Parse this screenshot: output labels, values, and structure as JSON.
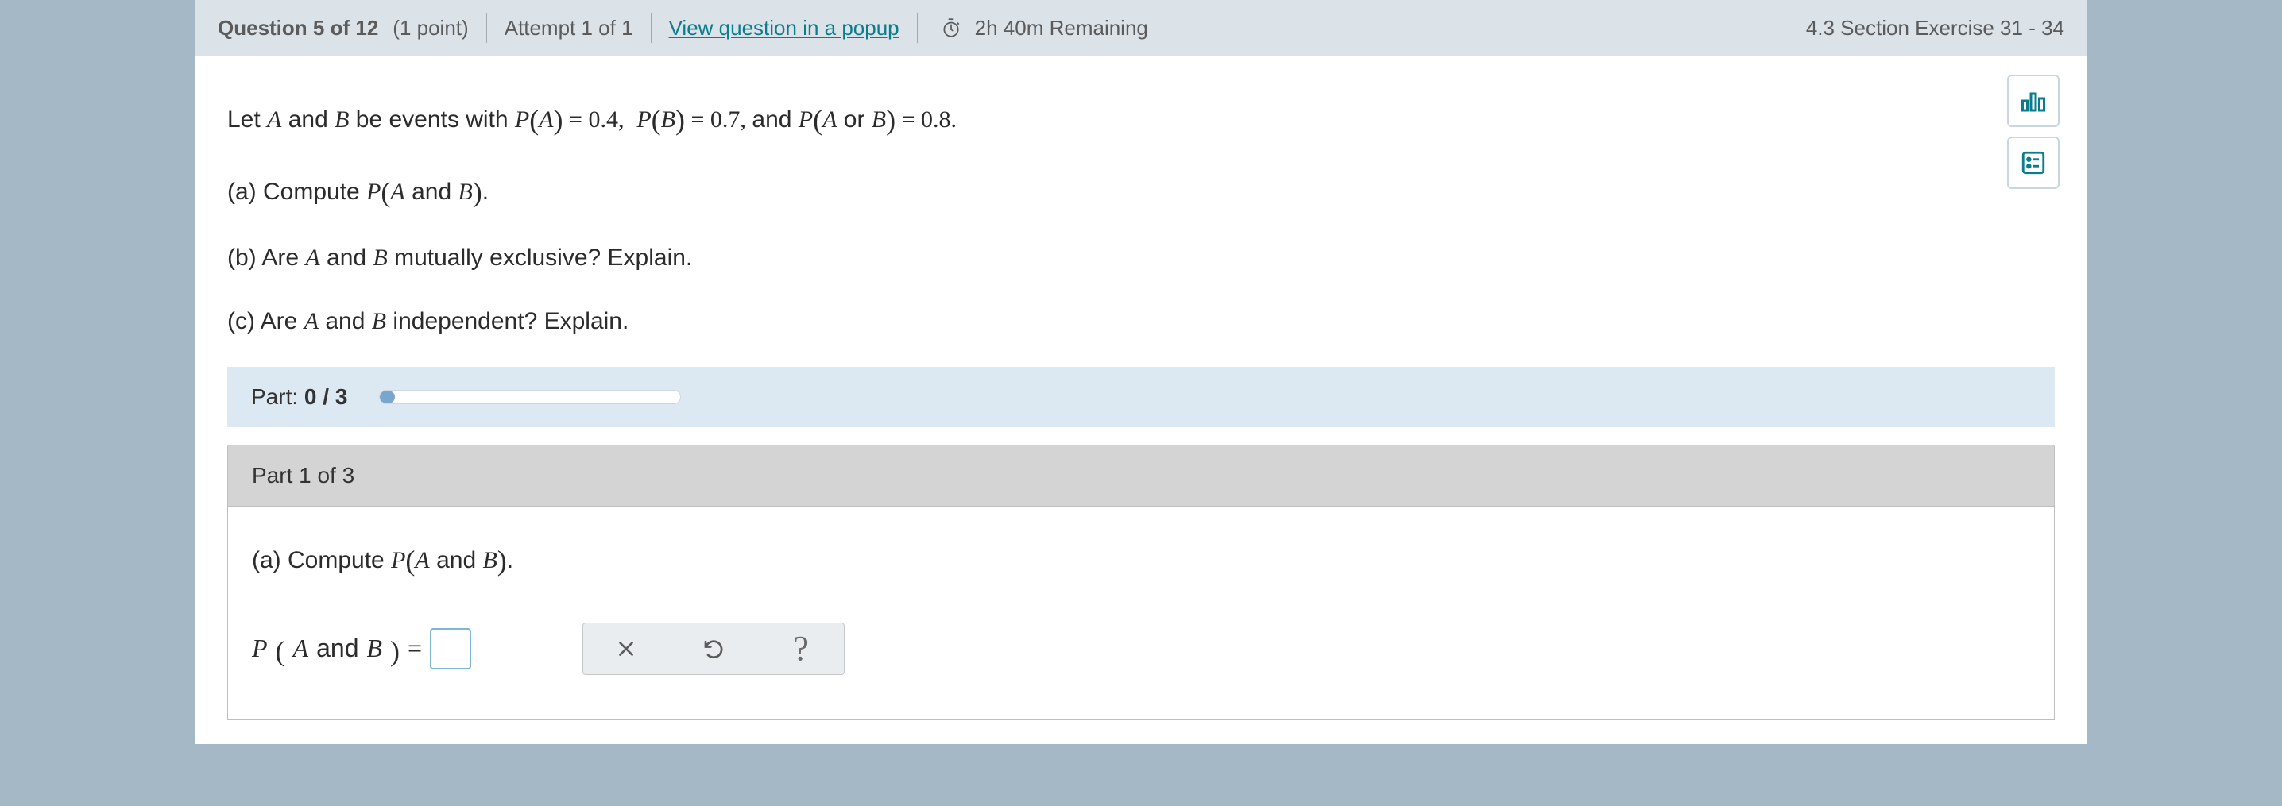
{
  "header": {
    "question_label_prefix": "Question ",
    "question_num": "5",
    "question_of": " of ",
    "question_total": "12",
    "points": "(1 point)",
    "attempt": "Attempt 1 of 1",
    "popup_link": "View question in a popup",
    "time_remaining": "2h 40m Remaining",
    "section_label": "4.3 Section Exercise 31 - 34"
  },
  "tools": {
    "chart_icon": "chart",
    "list_icon": "list"
  },
  "question": {
    "intro_prefix": "Let ",
    "A": "A",
    "and_word": " and ",
    "B": "B",
    "intro_suffix": " be events with ",
    "PA": "P",
    "PA_arg": "A",
    "PA_val": " = 0.4, ",
    "PB": "P",
    "PB_arg": "B",
    "PB_val": " = 0.7, ",
    "and2": " and ",
    "PAB": "P",
    "PAB_arg_A": "A",
    "or_word": " or ",
    "PAB_arg_B": "B",
    "PAB_val": " = 0.8.",
    "a_label": "(a) Compute ",
    "a_P": "P",
    "a_arg_A": "A",
    "a_and": " and ",
    "a_arg_B": "B",
    "a_end": ".",
    "b_text_pre": "(b) Are ",
    "b_A": "A",
    "b_and": " and ",
    "b_B": "B",
    "b_text_post": " mutually exclusive? Explain.",
    "c_text_pre": "(c) Are ",
    "c_A": "A",
    "c_and": " and ",
    "c_B": "B",
    "c_text_post": " independent? Explain."
  },
  "progress": {
    "label_prefix": "Part: ",
    "current": "0",
    "sep": " / ",
    "total": "3",
    "percent": 5
  },
  "part": {
    "header": "Part 1 of 3",
    "a_label": "(a) Compute ",
    "a_P": "P",
    "a_arg_A": "A",
    "a_and": " and ",
    "a_arg_B": "B",
    "a_end": ".",
    "ans_P": "P",
    "ans_arg_A": "A",
    "ans_and": " and ",
    "ans_arg_B": "B",
    "ans_eq": " = ",
    "answer_value": ""
  },
  "buttons": {
    "clear": "×",
    "reset": "↺",
    "help": "?"
  }
}
